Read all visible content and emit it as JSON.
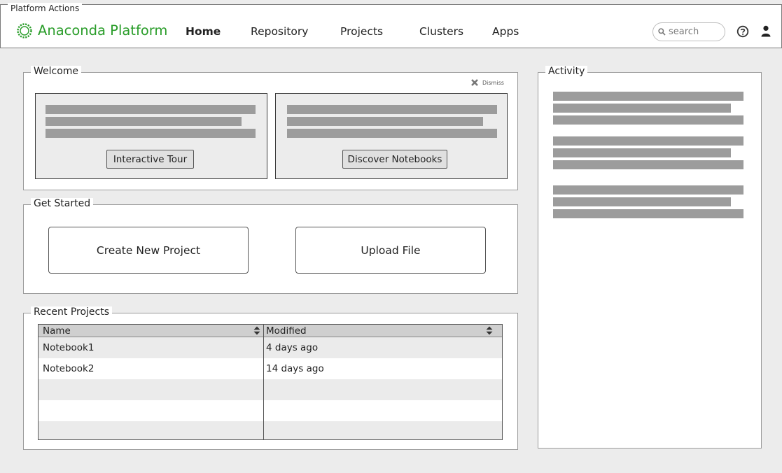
{
  "window": {
    "title": "Platform Actions"
  },
  "brand": {
    "name": "Anaconda Platform",
    "color": "#2a9d2a"
  },
  "nav": {
    "items": [
      {
        "label": "Home",
        "active": true
      },
      {
        "label": "Repository",
        "active": false
      },
      {
        "label": "Projects",
        "active": false
      },
      {
        "label": "Clusters",
        "active": false
      },
      {
        "label": "Apps",
        "active": false
      }
    ]
  },
  "search": {
    "placeholder": "search",
    "value": "",
    "icon": "search-icon"
  },
  "header_icons": {
    "help": "question-circle-icon",
    "user": "user-icon"
  },
  "welcome": {
    "title": "Welcome",
    "dismiss_label": "Dismiss",
    "dismiss_icon": "close-icon",
    "cards": [
      {
        "button_label": "Interactive Tour"
      },
      {
        "button_label": "Discover Notebooks"
      }
    ]
  },
  "get_started": {
    "title": "Get Started",
    "create_label": "Create New Project",
    "upload_label": "Upload File"
  },
  "recent_projects": {
    "title": "Recent Projects",
    "columns": [
      "Name",
      "Modified"
    ],
    "rows": [
      {
        "name": "Notebook1",
        "modified": "4 days ago"
      },
      {
        "name": "Notebook2",
        "modified": "14 days ago"
      },
      {
        "name": "",
        "modified": ""
      },
      {
        "name": "",
        "modified": ""
      },
      {
        "name": "",
        "modified": ""
      }
    ]
  },
  "activity": {
    "title": "Activity"
  },
  "colors": {
    "placeholder_bar": "#9c9c9c",
    "card_bg": "#ececec"
  }
}
